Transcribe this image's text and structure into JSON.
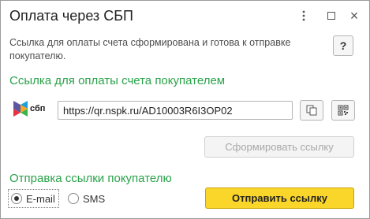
{
  "window": {
    "title": "Оплата через СБП",
    "menu_icon": "kebab-icon",
    "maximize_icon": "maximize-icon",
    "close_icon": "close-icon",
    "close_glyph": "×"
  },
  "info_text": "Ссылка для оплаты счета сформирована и готова к отправке покупателю.",
  "help_label": "?",
  "link_section": {
    "title": "Ссылка для оплаты счета покупателем",
    "logo_text": "сбп",
    "link_value": "https://qr.nspk.ru/AD10003R6I3OP02",
    "copy_icon": "copy-icon",
    "qr_icon": "qr-code-icon",
    "generate_label": "Сформировать ссылку"
  },
  "send_section": {
    "title": "Отправка ссылки покупателю",
    "options": [
      {
        "label": "E-mail",
        "selected": true
      },
      {
        "label": "SMS",
        "selected": false
      }
    ],
    "send_label": "Отправить ссылку"
  },
  "colors": {
    "section_title": "#2aa24a",
    "primary_button": "#fbd62a",
    "disabled_text": "#a8a8a8"
  }
}
